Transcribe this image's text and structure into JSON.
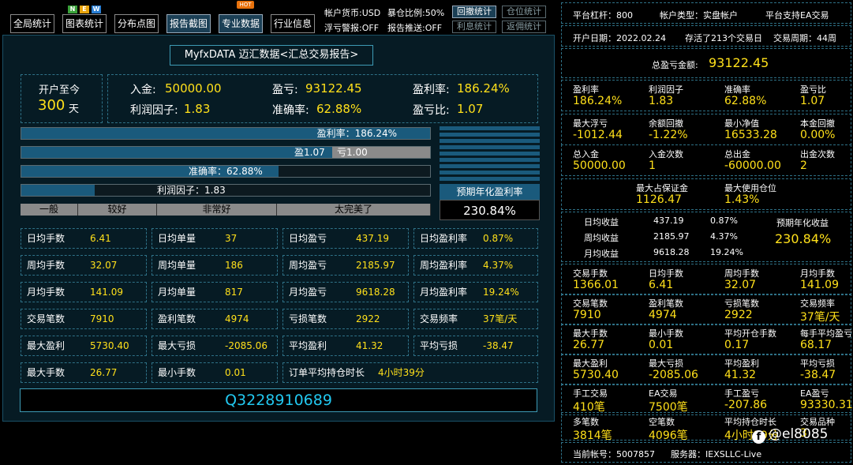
{
  "toolbar": {
    "buttons": [
      "全局统计",
      "图表统计",
      "分布点图",
      "报告截图",
      "专业数据",
      "行业信息"
    ],
    "badges": [
      "N",
      "E",
      "W"
    ],
    "hot": "HOT",
    "account_currency": "帐户货币:USD",
    "exposure_ratio": "暴仓比例:50%",
    "float_warning": "浮亏警报:OFF",
    "report_push": "报告推送:OFF",
    "small_buttons": [
      "回撤统计",
      "仓位统计",
      "利息统计",
      "返佣统计"
    ]
  },
  "report": {
    "title": "MyfxDATA 迈汇数据<汇总交易报告>",
    "open_since_label": "开户至今",
    "open_days": "300",
    "days_unit": "天",
    "deposit_label": "入金:",
    "deposit": "50000.00",
    "pnl_label": "盈亏:",
    "pnl": "93122.45",
    "profit_rate_label": "盈利率:",
    "profit_rate": "186.24%",
    "profit_factor_label": "利润因子:",
    "profit_factor": "1.83",
    "accuracy_label": "准确率:",
    "accuracy": "62.88%",
    "pl_ratio_label": "盈亏比:",
    "pl_ratio": "1.07"
  },
  "bars": {
    "profit_rate_text": "盈利率：186.24%",
    "profit_rate_fill": 1.0,
    "win_text": "盈1.07",
    "loss_text": "亏1.00",
    "win_fill": 0.76,
    "accuracy_text": "准确率：62.88%",
    "accuracy_fill": 0.63,
    "factor_text": "利润因子：1.83",
    "factor_fill": 0.18,
    "scale": [
      "一般",
      "较好",
      "非常好",
      "太完美了"
    ]
  },
  "annual": {
    "label": "预期年化盈利率",
    "value": "230.84%"
  },
  "grid": [
    [
      [
        "日均手数",
        "6.41"
      ],
      [
        "日均单量",
        "37"
      ],
      [
        "日均盈亏",
        "437.19"
      ],
      [
        "日均盈利率",
        "0.87%"
      ]
    ],
    [
      [
        "周均手数",
        "32.07"
      ],
      [
        "周均单量",
        "186"
      ],
      [
        "周均盈亏",
        "2185.97"
      ],
      [
        "周均盈利率",
        "4.37%"
      ]
    ],
    [
      [
        "月均手数",
        "141.09"
      ],
      [
        "月均单量",
        "817"
      ],
      [
        "月均盈亏",
        "9618.28"
      ],
      [
        "月均盈利率",
        "19.24%"
      ]
    ],
    [
      [
        "交易笔数",
        "7910"
      ],
      [
        "盈利笔数",
        "4974"
      ],
      [
        "亏损笔数",
        "2922"
      ],
      [
        "交易频率",
        "37笔/天"
      ]
    ],
    [
      [
        "最大盈利",
        "5730.40"
      ],
      [
        "最大亏损",
        "-2085.06"
      ],
      [
        "平均盈利",
        "41.32"
      ],
      [
        "平均亏损",
        "-38.47"
      ]
    ]
  ],
  "lastrow": {
    "max_lots_label": "最大手数",
    "max_lots": "26.77",
    "min_lots_label": "最小手数",
    "min_lots": "0.01",
    "hold_label": "订单平均持仓时长",
    "hold": "4小时39分"
  },
  "qq": "Q3228910689",
  "right": {
    "leverage": "平台杠杆：800",
    "account_type": "帐户类型：实盘帐户",
    "ea_support": "平台支持EA交易",
    "open_date": "开户日期：2022.02.24",
    "alive": "存活了213个交易日",
    "cycle": "交易周期：44周",
    "total_pnl_label": "总盈亏金额:",
    "total_pnl": "93122.45",
    "r1": [
      [
        "盈利率",
        "186.24%"
      ],
      [
        "利润因子",
        "1.83"
      ],
      [
        "准确率",
        "62.88%"
      ],
      [
        "盈亏比",
        "1.07"
      ]
    ],
    "r2": [
      [
        "最大浮亏",
        "-1012.44"
      ],
      [
        "余额回撤",
        "-1.22%"
      ],
      [
        "最小净值",
        "16533.28"
      ],
      [
        "本金回撤",
        "0.00%"
      ]
    ],
    "r3": [
      [
        "总入金",
        "50000.00"
      ],
      [
        "入金次数",
        "1"
      ],
      [
        "总出金",
        "-60000.00"
      ],
      [
        "出金次数",
        "2"
      ]
    ],
    "r4": [
      [
        "最大占保证金",
        "1126.47"
      ],
      [
        "最大使用仓位",
        "1.43%"
      ]
    ],
    "avg": [
      [
        "日均收益",
        "437.19",
        "0.87%"
      ],
      [
        "周均收益",
        "2185.97",
        "4.37%"
      ],
      [
        "月均收益",
        "9618.28",
        "19.24%"
      ]
    ],
    "annual_label": "预期年化收益",
    "annual_value": "230.84%",
    "r5": [
      [
        "交易手数",
        "1366.01"
      ],
      [
        "日均手数",
        "6.41"
      ],
      [
        "周均手数",
        "32.07"
      ],
      [
        "月均手数",
        "141.09"
      ]
    ],
    "r6": [
      [
        "交易笔数",
        "7910"
      ],
      [
        "盈利笔数",
        "4974"
      ],
      [
        "亏损笔数",
        "2922"
      ],
      [
        "交易频率",
        "37笔/天"
      ]
    ],
    "r7": [
      [
        "最大手数",
        "26.77"
      ],
      [
        "最小手数",
        "0.01"
      ],
      [
        "平均开仓手数",
        "0.17"
      ],
      [
        "每手平均盈亏",
        "68.17"
      ]
    ],
    "r8": [
      [
        "最大盈利",
        "5730.40"
      ],
      [
        "最大亏损",
        "-2085.06"
      ],
      [
        "平均盈利",
        "41.32"
      ],
      [
        "平均亏损",
        "-38.47"
      ]
    ],
    "r9": [
      [
        "手工交易",
        "410笔"
      ],
      [
        "EA交易",
        "7500笔"
      ],
      [
        "手工盈亏",
        "-207.86"
      ],
      [
        "EA盈亏",
        "93330.31"
      ]
    ],
    "r10": [
      [
        "多笔数",
        "3814笔"
      ],
      [
        "空笔数",
        "4096笔"
      ],
      [
        "平均持仓时长",
        "4小时39分"
      ],
      [
        "交易品种",
        "3"
      ]
    ],
    "account_no": "当前帐号：5007857",
    "server": "服务器：IEXSLLC-Live"
  },
  "watermark": "@el8085",
  "colors": {
    "accent": "#ffe01a",
    "panel": "#061b24",
    "bar": "#1a5a7c",
    "border": "#2e7187"
  }
}
